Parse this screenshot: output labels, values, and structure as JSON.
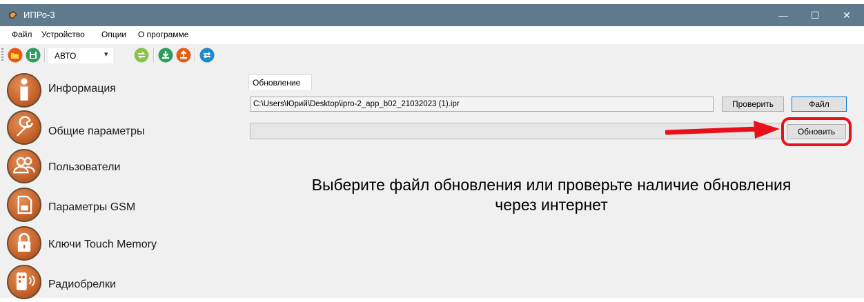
{
  "window": {
    "title": "ИПРо-3",
    "controls": {
      "minimize": "—",
      "maximize": "☐",
      "close": "✕"
    }
  },
  "menu": [
    "Файл",
    "Устройство",
    "Опции",
    "О программе"
  ],
  "toolbar": {
    "mode": "АВТО",
    "icons": [
      "open-folder-icon",
      "save-icon",
      "sync-icon",
      "download-icon",
      "upload-icon",
      "refresh-icon"
    ]
  },
  "sidebar": {
    "items": [
      {
        "label": "Информация",
        "icon": "info-icon"
      },
      {
        "label": "Общие параметры",
        "icon": "wrench-icon"
      },
      {
        "label": "Пользователи",
        "icon": "users-icon"
      },
      {
        "label": "Параметры GSM",
        "icon": "sim-card-icon"
      },
      {
        "label": "Ключи Touch Memory",
        "icon": "lock-icon"
      },
      {
        "label": "Радиобрелки",
        "icon": "remote-fob-icon"
      }
    ]
  },
  "main": {
    "tab": "Обновление",
    "file_path": "C:\\Users\\Юрий\\Desktop\\ipro-2_app_b02_21032023 (1).ipr",
    "check_button": "Проверить",
    "file_button": "Файл",
    "update_button": "Обновить",
    "message_line1": "Выберите файл обновления или проверьте наличие обновления",
    "message_line2": "через интернет"
  },
  "colors": {
    "accent_orange": "#c8652e",
    "highlight_red": "#e8101b",
    "titlebar": "#5f7a8c",
    "focus_blue": "#0078d7"
  }
}
